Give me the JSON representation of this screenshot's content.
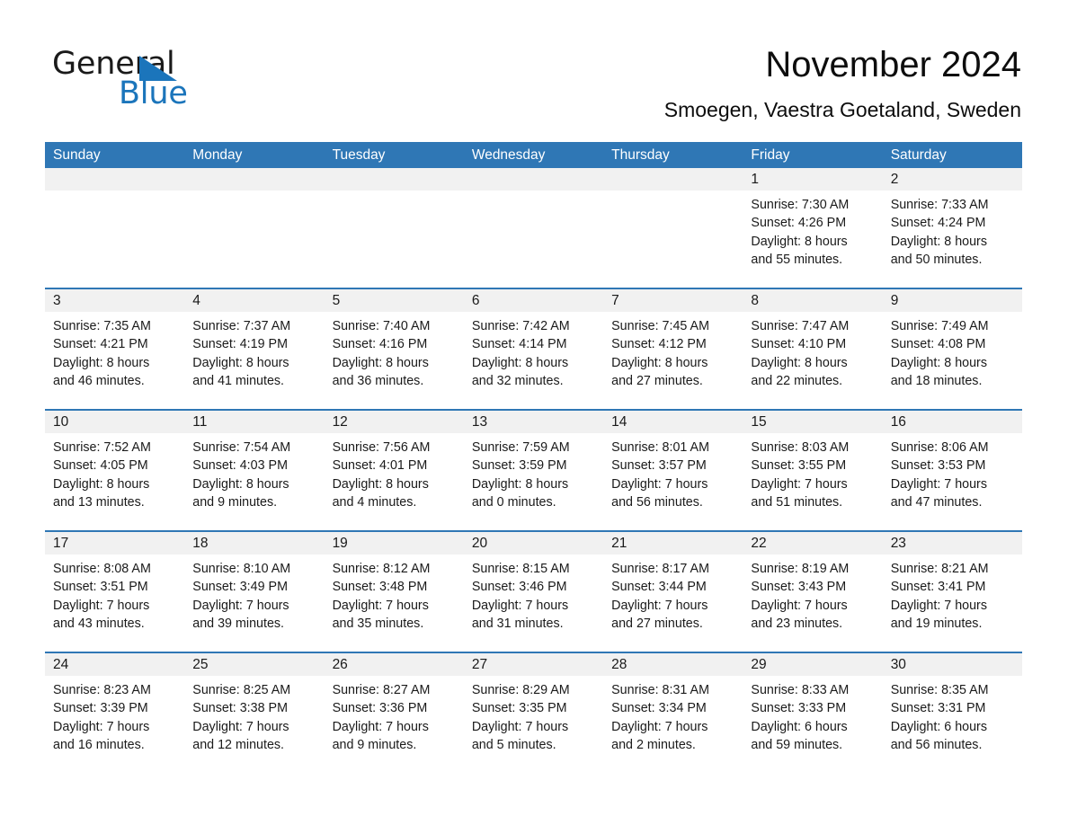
{
  "brand": {
    "word_one": "General",
    "word_two": "Blue",
    "accent_color": "#1b75bb"
  },
  "header": {
    "title": "November 2024",
    "subtitle": "Smoegen, Vaestra Goetaland, Sweden"
  },
  "theme": {
    "header_blue": "#2f77b5",
    "date_band_gray": "#f1f1f1",
    "text_dark": "#1a1a1a"
  },
  "weekdays": [
    "Sunday",
    "Monday",
    "Tuesday",
    "Wednesday",
    "Thursday",
    "Friday",
    "Saturday"
  ],
  "weeks": [
    [
      {
        "day": "",
        "lines": []
      },
      {
        "day": "",
        "lines": []
      },
      {
        "day": "",
        "lines": []
      },
      {
        "day": "",
        "lines": []
      },
      {
        "day": "",
        "lines": []
      },
      {
        "day": "1",
        "lines": [
          "Sunrise: 7:30 AM",
          "Sunset: 4:26 PM",
          "Daylight: 8 hours",
          "and 55 minutes."
        ]
      },
      {
        "day": "2",
        "lines": [
          "Sunrise: 7:33 AM",
          "Sunset: 4:24 PM",
          "Daylight: 8 hours",
          "and 50 minutes."
        ]
      }
    ],
    [
      {
        "day": "3",
        "lines": [
          "Sunrise: 7:35 AM",
          "Sunset: 4:21 PM",
          "Daylight: 8 hours",
          "and 46 minutes."
        ]
      },
      {
        "day": "4",
        "lines": [
          "Sunrise: 7:37 AM",
          "Sunset: 4:19 PM",
          "Daylight: 8 hours",
          "and 41 minutes."
        ]
      },
      {
        "day": "5",
        "lines": [
          "Sunrise: 7:40 AM",
          "Sunset: 4:16 PM",
          "Daylight: 8 hours",
          "and 36 minutes."
        ]
      },
      {
        "day": "6",
        "lines": [
          "Sunrise: 7:42 AM",
          "Sunset: 4:14 PM",
          "Daylight: 8 hours",
          "and 32 minutes."
        ]
      },
      {
        "day": "7",
        "lines": [
          "Sunrise: 7:45 AM",
          "Sunset: 4:12 PM",
          "Daylight: 8 hours",
          "and 27 minutes."
        ]
      },
      {
        "day": "8",
        "lines": [
          "Sunrise: 7:47 AM",
          "Sunset: 4:10 PM",
          "Daylight: 8 hours",
          "and 22 minutes."
        ]
      },
      {
        "day": "9",
        "lines": [
          "Sunrise: 7:49 AM",
          "Sunset: 4:08 PM",
          "Daylight: 8 hours",
          "and 18 minutes."
        ]
      }
    ],
    [
      {
        "day": "10",
        "lines": [
          "Sunrise: 7:52 AM",
          "Sunset: 4:05 PM",
          "Daylight: 8 hours",
          "and 13 minutes."
        ]
      },
      {
        "day": "11",
        "lines": [
          "Sunrise: 7:54 AM",
          "Sunset: 4:03 PM",
          "Daylight: 8 hours",
          "and 9 minutes."
        ]
      },
      {
        "day": "12",
        "lines": [
          "Sunrise: 7:56 AM",
          "Sunset: 4:01 PM",
          "Daylight: 8 hours",
          "and 4 minutes."
        ]
      },
      {
        "day": "13",
        "lines": [
          "Sunrise: 7:59 AM",
          "Sunset: 3:59 PM",
          "Daylight: 8 hours",
          "and 0 minutes."
        ]
      },
      {
        "day": "14",
        "lines": [
          "Sunrise: 8:01 AM",
          "Sunset: 3:57 PM",
          "Daylight: 7 hours",
          "and 56 minutes."
        ]
      },
      {
        "day": "15",
        "lines": [
          "Sunrise: 8:03 AM",
          "Sunset: 3:55 PM",
          "Daylight: 7 hours",
          "and 51 minutes."
        ]
      },
      {
        "day": "16",
        "lines": [
          "Sunrise: 8:06 AM",
          "Sunset: 3:53 PM",
          "Daylight: 7 hours",
          "and 47 minutes."
        ]
      }
    ],
    [
      {
        "day": "17",
        "lines": [
          "Sunrise: 8:08 AM",
          "Sunset: 3:51 PM",
          "Daylight: 7 hours",
          "and 43 minutes."
        ]
      },
      {
        "day": "18",
        "lines": [
          "Sunrise: 8:10 AM",
          "Sunset: 3:49 PM",
          "Daylight: 7 hours",
          "and 39 minutes."
        ]
      },
      {
        "day": "19",
        "lines": [
          "Sunrise: 8:12 AM",
          "Sunset: 3:48 PM",
          "Daylight: 7 hours",
          "and 35 minutes."
        ]
      },
      {
        "day": "20",
        "lines": [
          "Sunrise: 8:15 AM",
          "Sunset: 3:46 PM",
          "Daylight: 7 hours",
          "and 31 minutes."
        ]
      },
      {
        "day": "21",
        "lines": [
          "Sunrise: 8:17 AM",
          "Sunset: 3:44 PM",
          "Daylight: 7 hours",
          "and 27 minutes."
        ]
      },
      {
        "day": "22",
        "lines": [
          "Sunrise: 8:19 AM",
          "Sunset: 3:43 PM",
          "Daylight: 7 hours",
          "and 23 minutes."
        ]
      },
      {
        "day": "23",
        "lines": [
          "Sunrise: 8:21 AM",
          "Sunset: 3:41 PM",
          "Daylight: 7 hours",
          "and 19 minutes."
        ]
      }
    ],
    [
      {
        "day": "24",
        "lines": [
          "Sunrise: 8:23 AM",
          "Sunset: 3:39 PM",
          "Daylight: 7 hours",
          "and 16 minutes."
        ]
      },
      {
        "day": "25",
        "lines": [
          "Sunrise: 8:25 AM",
          "Sunset: 3:38 PM",
          "Daylight: 7 hours",
          "and 12 minutes."
        ]
      },
      {
        "day": "26",
        "lines": [
          "Sunrise: 8:27 AM",
          "Sunset: 3:36 PM",
          "Daylight: 7 hours",
          "and 9 minutes."
        ]
      },
      {
        "day": "27",
        "lines": [
          "Sunrise: 8:29 AM",
          "Sunset: 3:35 PM",
          "Daylight: 7 hours",
          "and 5 minutes."
        ]
      },
      {
        "day": "28",
        "lines": [
          "Sunrise: 8:31 AM",
          "Sunset: 3:34 PM",
          "Daylight: 7 hours",
          "and 2 minutes."
        ]
      },
      {
        "day": "29",
        "lines": [
          "Sunrise: 8:33 AM",
          "Sunset: 3:33 PM",
          "Daylight: 6 hours",
          "and 59 minutes."
        ]
      },
      {
        "day": "30",
        "lines": [
          "Sunrise: 8:35 AM",
          "Sunset: 3:31 PM",
          "Daylight: 6 hours",
          "and 56 minutes."
        ]
      }
    ]
  ]
}
